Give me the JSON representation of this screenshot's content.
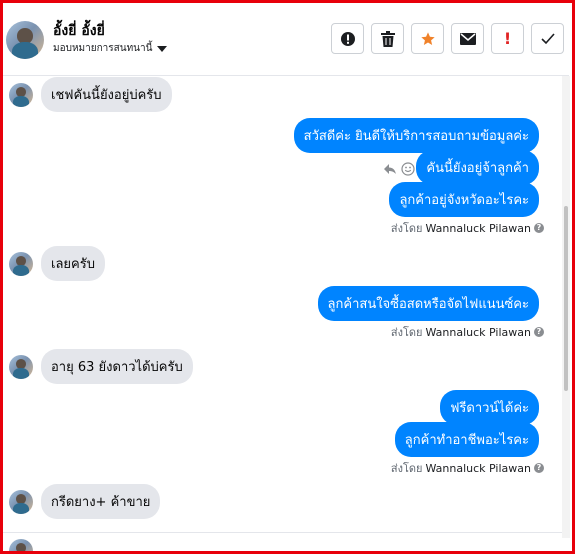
{
  "header": {
    "name": "อั้งยี่ อั้งยี่",
    "assign_label": "มอบหมายการสนทนานี้",
    "toolbar": [
      {
        "icon": "alert-circle-icon",
        "label": ""
      },
      {
        "icon": "trash-icon",
        "label": ""
      },
      {
        "icon": "star-icon",
        "label": "",
        "color": "#f0822a"
      },
      {
        "icon": "mail-icon",
        "label": ""
      },
      {
        "icon": "exclamation-icon",
        "label": "!",
        "color": "#e02424"
      },
      {
        "icon": "check-icon",
        "label": ""
      }
    ]
  },
  "messages": [
    {
      "from": "customer",
      "text": "เชฟคันนี้ยังอยู่บ่ครับ"
    },
    {
      "from": "page",
      "text": "สวัสดีค่ะ  ยินดีให้บริการสอบถามข้อมูลค่ะ"
    },
    {
      "from": "page",
      "text": "คันนี้ยังอยู่จ้าลูกค้า"
    },
    {
      "from": "page",
      "text": "ลูกค้าอยู่จังหวัดอะไรคะ"
    },
    {
      "from": "customer",
      "text": "เลยครับ"
    },
    {
      "from": "page",
      "text": "ลูกค้าสนใจซื้อสดหรือจัดไฟแนนซ์คะ"
    },
    {
      "from": "customer",
      "text": "อายุ 63 ยังดาวได้บ่ครับ"
    },
    {
      "from": "page",
      "text": "ฟรีดาวน์ได้ค่ะ"
    },
    {
      "from": "page",
      "text": "ลูกค้าทำอาชีพอะไรคะ"
    },
    {
      "from": "customer",
      "text": "กรีดยาง+ ค้าขาย"
    }
  ],
  "sent_by": {
    "prefix": "ส่งโดย",
    "agent": "Wannaluck Pilawan"
  },
  "colors": {
    "frame": "#e8000b",
    "outgoing_bubble": "#0084ff",
    "incoming_bubble": "#e4e6eb"
  }
}
